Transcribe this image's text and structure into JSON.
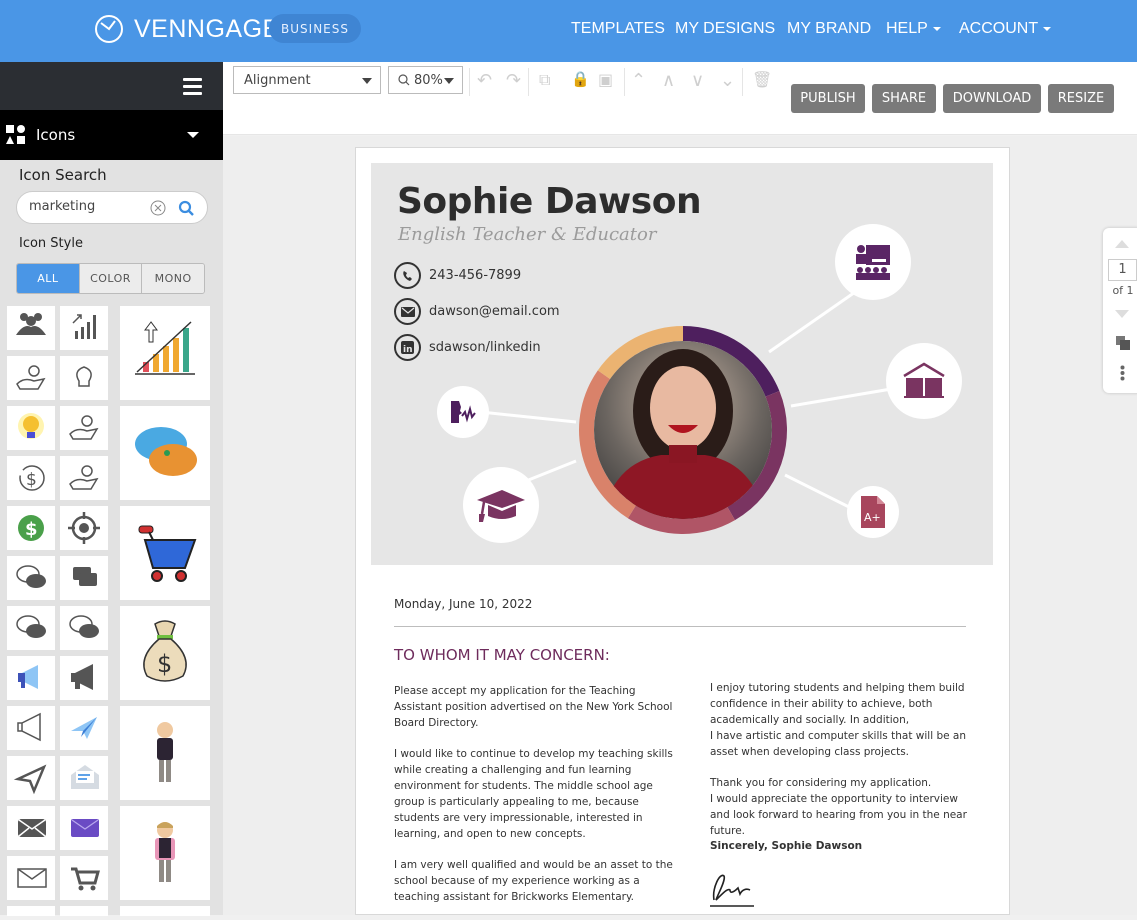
{
  "header": {
    "brand": "VENNGAGE",
    "plan_badge": "BUSINESS",
    "nav": [
      "TEMPLATES",
      "MY DESIGNS",
      "MY BRAND",
      "HELP",
      "ACCOUNT"
    ],
    "colors": {
      "primary": "#4a96e6",
      "dark": "#2b2e33"
    }
  },
  "sidebar": {
    "category": "Icons",
    "search_title": "Icon Search",
    "search_value": "marketing",
    "style_title": "Icon Style",
    "style_options": [
      "ALL",
      "COLOR",
      "MONO"
    ],
    "style_selected": "ALL",
    "icons": [
      "people-group",
      "growth-bars",
      "hand-coins",
      "lightbulb-outline",
      "lightbulb-color",
      "money-hand",
      "dollar-refresh",
      "money-hand-outline",
      "dollar-circle-green",
      "target",
      "chat-bubbles-outline",
      "chat-bubbles-solid",
      "chat-bubbles-dotted",
      "chat-bubble-solid-outline",
      "megaphone-blue",
      "megaphone-solid",
      "megaphone-outline",
      "paper-plane-blue",
      "paper-plane-outline",
      "open-envelope",
      "envelope-solid",
      "envelope-purple",
      "envelope-outline",
      "shopping-cart"
    ],
    "large_icons": [
      "growth-chart-color",
      "chat-eye-color",
      "shopping-cart-color",
      "money-bag",
      "character-old-man",
      "character-young-man"
    ]
  },
  "toolbar": {
    "alignment_label": "Alignment",
    "zoom_label": "80%",
    "actions": [
      "PUBLISH",
      "SHARE",
      "DOWNLOAD",
      "RESIZE"
    ]
  },
  "pager": {
    "current": "1",
    "total_label": "of 1"
  },
  "document": {
    "name": "Sophie Dawson",
    "title": "English Teacher & Educator",
    "phone": "243-456-7899",
    "email": "dawson@email.com",
    "linkedin": "sdawson/linkedin",
    "date": "Monday, June 10, 2022",
    "salutation": "TO WHOM IT MAY CONCERN:",
    "left_paragraphs": [
      "Please accept my application for the Teaching Assistant position advertised on the New York School Board Directory.",
      "I would like to continue to develop my teaching skills while creating a challenging and fun learning environment for students. The middle school age group is particularly appealing to me, because students are very impressionable, interested in learning, and open to new concepts.",
      "I am very well qualified and would be an asset to the school because of my experience working as a teaching assistant for Brickworks Elementary."
    ],
    "right_paragraphs": [
      "I enjoy tutoring students and helping them build confidence in their ability to achieve, both academically and socially. In addition,",
      "I have artistic and computer skills that will be an asset when developing class projects.",
      "Thank you for considering my application.",
      "I would appreciate the opportunity to interview and look forward to hearing from you in the near future."
    ],
    "closing": "Sincerely, Sophie Dawson",
    "ring_colors": [
      "#4e1f5e",
      "#7a3461",
      "#b05566",
      "#d9826a",
      "#ebb371"
    ],
    "accent": "#6e2b5c"
  }
}
